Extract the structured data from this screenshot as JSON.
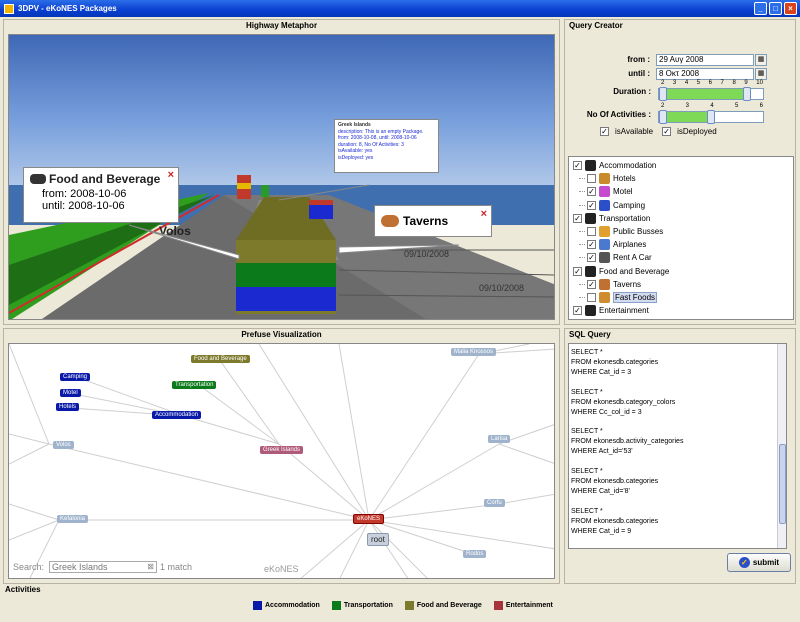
{
  "window": {
    "title": "3DPV - eKoNES Packages",
    "minimize": "_",
    "maximize": "□",
    "close": "×"
  },
  "highway": {
    "title": "Highway Metaphor",
    "popup_food": {
      "name": "Food and Beverage",
      "from": "from: 2008-10-06",
      "until": "until: 2008-10-06",
      "close": "×"
    },
    "popup_tavern": {
      "name": "Taverns",
      "close": "×"
    },
    "popup_greek": {
      "title": "Greek Islands",
      "lines": [
        "description: This is an empty Package.",
        "from: 2008-10-08,  until: 2008-10-06",
        "duration: 8,    No Of Activities: 3",
        "isAvailable: yes",
        "isDeployed: yes"
      ]
    },
    "road_label_volos": "Volos",
    "road_date_1": "09/10/2008",
    "road_date_2": "09/10/2008",
    "colors": {
      "sky": "#5a86c9",
      "sea": "#3f6fae",
      "ground": "#6a6a6a",
      "grass": "#2f9e1e"
    }
  },
  "prefuse": {
    "title": "Prefuse Visualization",
    "nodes": {
      "food": "Food and Beverage",
      "camping": "Camping",
      "transportation": "Transportation",
      "motel": "Motel",
      "hotels": "Hotels",
      "accommodation": "Accommodation",
      "volos": "Volos",
      "greek": "Greek Islands",
      "malia": "Malia Knossos",
      "larissa": "Larisa",
      "corfu": "Corfu",
      "kefalonia": "Kefalonia",
      "ekones": "eKoNES",
      "root": "root",
      "rodos": "Rodos"
    },
    "search_label": "Search:",
    "search_value": "Greek Islands",
    "match": "1 match",
    "watermark": "eKoNES"
  },
  "query": {
    "title": "Query Creator",
    "from_label": "from :",
    "from_value": "29 Αυγ 2008",
    "until_label": "until :",
    "until_value": "8 Οκτ 2008",
    "duration_label": "Duration :",
    "duration_ticks": [
      "2",
      "3",
      "4",
      "5",
      "6",
      "7",
      "8",
      "9",
      "10"
    ],
    "duration_range": [
      2,
      9
    ],
    "activities_label": "No Of Activities :",
    "activities_ticks": [
      "2",
      "3",
      "4",
      "5",
      "6"
    ],
    "activities_range": [
      2,
      4
    ],
    "is_available": "isAvailable",
    "is_deployed": "isDeployed"
  },
  "tree": [
    {
      "label": "Accommodation",
      "level": 0,
      "checked": true,
      "color": "#222222"
    },
    {
      "label": "Hotels",
      "level": 1,
      "checked": false,
      "color": "#c98a2b"
    },
    {
      "label": "Motel",
      "level": 1,
      "checked": true,
      "color": "#c44bd0"
    },
    {
      "label": "Camping",
      "level": 1,
      "checked": true,
      "color": "#2b4fc9"
    },
    {
      "label": "Transportation",
      "level": 0,
      "checked": true,
      "color": "#222222"
    },
    {
      "label": "Public Busses",
      "level": 1,
      "checked": false,
      "color": "#e0a030"
    },
    {
      "label": "Airplanes",
      "level": 1,
      "checked": true,
      "color": "#4a7ad0"
    },
    {
      "label": "Rent A Car",
      "level": 1,
      "checked": true,
      "color": "#555555"
    },
    {
      "label": "Food and Beverage",
      "level": 0,
      "checked": true,
      "color": "#222222"
    },
    {
      "label": "Taverns",
      "level": 1,
      "checked": true,
      "color": "#c07030"
    },
    {
      "label": "Fast Foods",
      "level": 1,
      "checked": false,
      "color": "#d08a30"
    },
    {
      "label": "Entertainment",
      "level": 0,
      "checked": true,
      "color": "#222222"
    }
  ],
  "sql": {
    "title": "SQL Query",
    "blocks": [
      "SELECT *\nFROM ekonesdb.categories\nWHERE Cat_id = 3",
      "SELECT *\nFROM ekonesdb.category_colors\nWHERE Cc_col_id = 3",
      "SELECT *\nFROM ekonesdb.activity_categories\nWHERE Act_id='53'",
      "SELECT *\nFROM ekonesdb.categories\nWHERE Cat_id='8'",
      "SELECT *\nFROM ekonesdb.categories\nWHERE Cat_id = 9"
    ],
    "submit": "submit"
  },
  "activities": {
    "title": "Activities",
    "items": [
      {
        "label": "Accommodation",
        "color": "#0a1aa8"
      },
      {
        "label": "Transportation",
        "color": "#0b7a1a"
      },
      {
        "label": "Food and Beverage",
        "color": "#7d7a2b"
      },
      {
        "label": "Entertainment",
        "color": "#a8323a"
      }
    ]
  }
}
